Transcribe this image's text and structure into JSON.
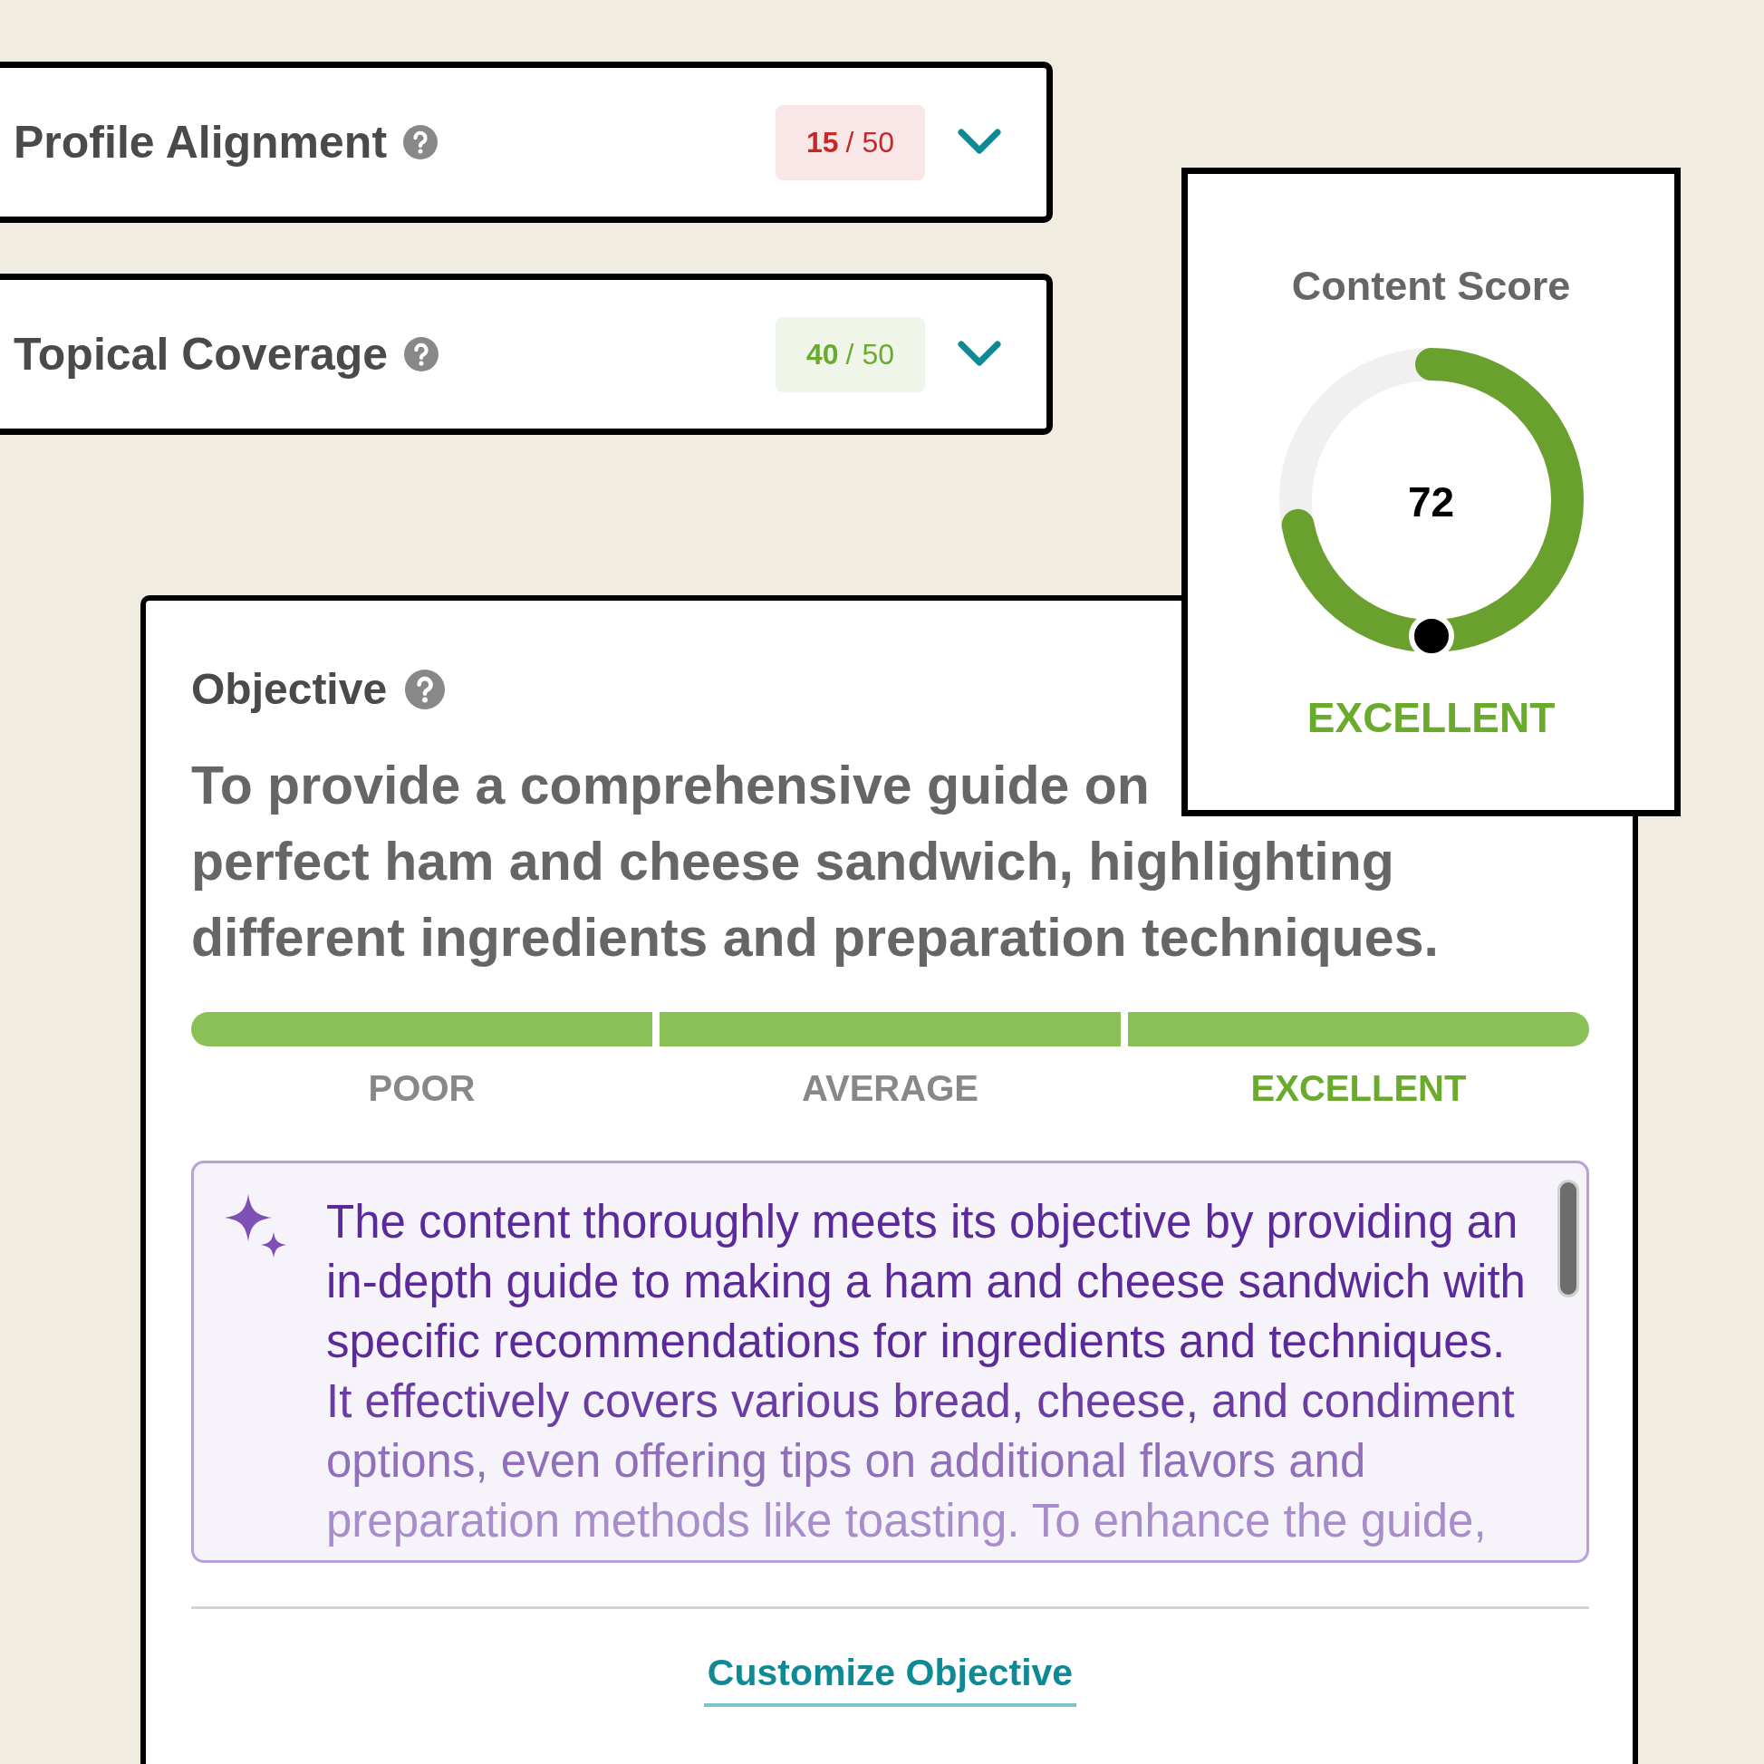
{
  "criteria": [
    {
      "title": "Profile Alignment",
      "score": "15",
      "max": "/ 50",
      "color": "#c62828",
      "expanded": false
    },
    {
      "title": "Topical Coverage",
      "score": "40",
      "max": "/ 50",
      "color": "#6aaa2c",
      "expanded": false
    }
  ],
  "objective": {
    "title": "Objective",
    "text_lines": [
      "To provide a comprehensive guide on",
      "perfect ham and cheese sandwich, highlighting",
      "different ingredients and preparation techniques."
    ],
    "rating_scale": [
      {
        "label": "POOR",
        "selected": false
      },
      {
        "label": "AVERAGE",
        "selected": false
      },
      {
        "label": "EXCELLENT",
        "selected": true
      }
    ],
    "feedback_lines": [
      "The content thoroughly meets its objective by providing an",
      "in-depth guide to making a ham and cheese sandwich with",
      "specific recommendations for ingredients and techniques.",
      "It effectively covers various bread, cheese, and condiment",
      "options, even offering tips on additional flavors and",
      "preparation methods like toasting. To enhance the guide,"
    ],
    "link": "Customize Objective"
  },
  "content_score": {
    "title": "Content Score",
    "score": "72",
    "level": 0.72,
    "rating": "EXCELLENT"
  }
}
